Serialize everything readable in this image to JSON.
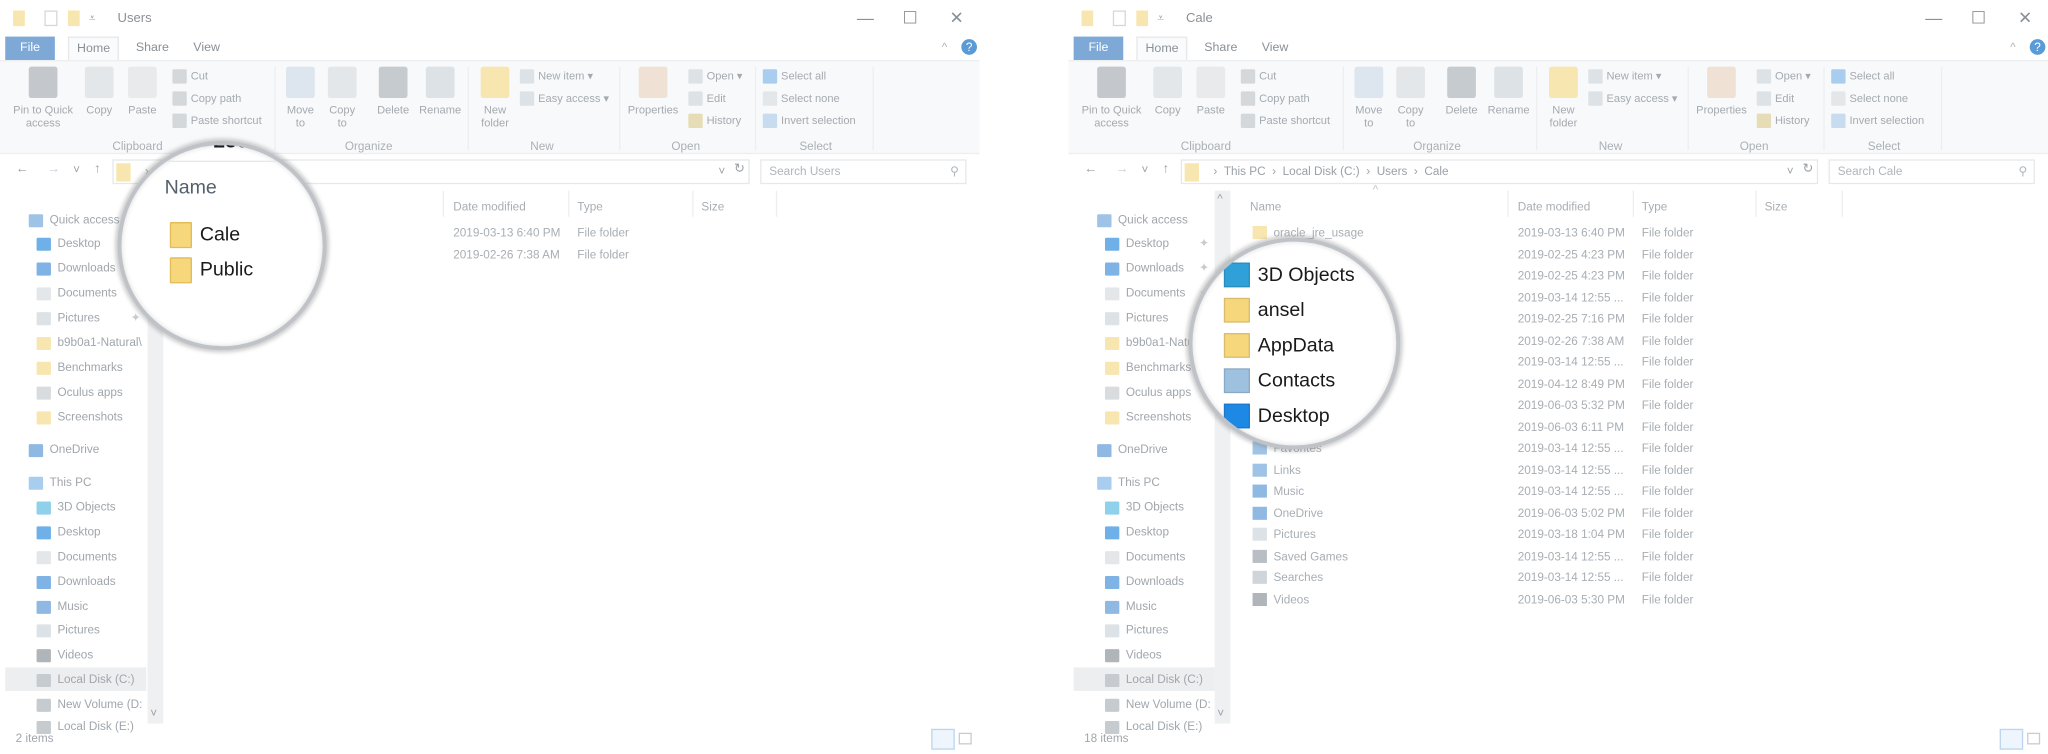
{
  "colors": {
    "file_tab": "#7ea9d6",
    "folder": "#f6d77c",
    "selection": "#eceef0"
  },
  "ribbon": {
    "tabs": [
      "File",
      "Home",
      "Share",
      "View"
    ],
    "clipboard": {
      "label": "Clipboard",
      "pin": "Pin to Quick access",
      "copy": "Copy",
      "paste": "Paste",
      "cut": "Cut",
      "copy_path": "Copy path",
      "paste_shortcut": "Paste shortcut"
    },
    "organize": {
      "label": "Organize",
      "move_to": "Move to",
      "copy_to": "Copy to",
      "delete": "Delete",
      "rename": "Rename"
    },
    "new": {
      "label": "New",
      "new_folder": "New folder",
      "new_item": "New item ▾",
      "easy_access": "Easy access ▾"
    },
    "open": {
      "label": "Open",
      "properties": "Properties",
      "open": "Open ▾",
      "edit": "Edit",
      "history": "History"
    },
    "select": {
      "label": "Select",
      "select_all": "Select all",
      "select_none": "Select none",
      "invert": "Invert selection"
    }
  },
  "columns": {
    "name": "Name",
    "date": "Date modified",
    "type": "Type",
    "size": "Size"
  },
  "nav_items": [
    {
      "label": "Quick access",
      "icon": "star-icon"
    },
    {
      "label": "Desktop",
      "icon": "desktop-icon",
      "pinned": true
    },
    {
      "label": "Downloads",
      "icon": "download-icon",
      "pinned": true
    },
    {
      "label": "Documents",
      "icon": "document-icon",
      "pinned": true
    },
    {
      "label": "Pictures",
      "icon": "pictures-icon",
      "pinned": true
    },
    {
      "label": "b9b0a1-Natural\\",
      "icon": "folder-icon"
    },
    {
      "label": "Benchmarks",
      "icon": "folder-icon"
    },
    {
      "label": "Oculus apps",
      "icon": "oculus-icon"
    },
    {
      "label": "Screenshots",
      "icon": "folder-icon"
    },
    {
      "label": "OneDrive",
      "icon": "cloud-icon"
    },
    {
      "label": "This PC",
      "icon": "computer-icon"
    },
    {
      "label": "3D Objects",
      "icon": "cube-icon"
    },
    {
      "label": "Desktop",
      "icon": "desktop-icon"
    },
    {
      "label": "Documents",
      "icon": "document-icon"
    },
    {
      "label": "Downloads",
      "icon": "download-icon"
    },
    {
      "label": "Music",
      "icon": "music-icon"
    },
    {
      "label": "Pictures",
      "icon": "pictures-icon"
    },
    {
      "label": "Videos",
      "icon": "video-icon"
    },
    {
      "label": "Local Disk (C:)",
      "icon": "drive-icon",
      "selected": true
    },
    {
      "label": "New Volume (D:",
      "icon": "drive-icon"
    },
    {
      "label": "Local Disk (E:)",
      "icon": "drive-icon"
    }
  ],
  "windows": [
    {
      "title": "Users",
      "breadcrumb": [
        "Users"
      ],
      "search_placeholder": "Search Users",
      "status": "2 items",
      "rows": [
        {
          "name": "Cale",
          "date": "2019-03-13 6:40 PM",
          "type": "File folder"
        },
        {
          "name": "Public",
          "date": "2019-02-26 7:38 AM",
          "type": "File folder"
        }
      ],
      "magnifier": {
        "header": "Name",
        "top_fragment": "Loc",
        "items": [
          {
            "name": "Cale",
            "icon": "folder-icon"
          },
          {
            "name": "Public",
            "icon": "folder-icon"
          }
        ]
      }
    },
    {
      "title": "Cale",
      "breadcrumb": [
        "This PC",
        "Local Disk (C:)",
        "Users",
        "Cale"
      ],
      "search_placeholder": "Search Cale",
      "status": "18 items",
      "rows": [
        {
          "name": "oracle_jre_usage",
          "icon": "folder-icon",
          "date": "2019-03-13 6:40 PM",
          "type": "File folder"
        },
        {
          "name": "",
          "icon": "folder-icon",
          "date": "2019-02-25 4:23 PM",
          "type": "File folder"
        },
        {
          "name": "",
          "icon": "folder-icon",
          "date": "2019-02-25 4:23 PM",
          "type": "File folder"
        },
        {
          "name": "3D Objects",
          "icon": "cube-icon",
          "date": "2019-03-14 12:55 ...",
          "type": "File folder"
        },
        {
          "name": "ansel",
          "icon": "folder-icon",
          "date": "2019-02-25 7:16 PM",
          "type": "File folder"
        },
        {
          "name": "AppData",
          "icon": "folder-icon",
          "date": "2019-02-26 7:38 AM",
          "type": "File folder"
        },
        {
          "name": "Contacts",
          "icon": "contacts-icon",
          "date": "2019-03-14 12:55 ...",
          "type": "File folder"
        },
        {
          "name": "Desktop",
          "icon": "desktop-icon",
          "date": "2019-04-12 8:49 PM",
          "type": "File folder"
        },
        {
          "name": "",
          "icon": "document-icon",
          "date": "2019-06-03 5:32 PM",
          "type": "File folder"
        },
        {
          "name": "",
          "icon": "download-icon",
          "date": "2019-06-03 6:11 PM",
          "type": "File folder"
        },
        {
          "name": "Favorites",
          "icon": "star-icon",
          "date": "2019-03-14 12:55 ...",
          "type": "File folder"
        },
        {
          "name": "Links",
          "icon": "link-icon",
          "date": "2019-03-14 12:55 ...",
          "type": "File folder"
        },
        {
          "name": "Music",
          "icon": "music-icon",
          "date": "2019-03-14 12:55 ...",
          "type": "File folder"
        },
        {
          "name": "OneDrive",
          "icon": "cloud-icon",
          "date": "2019-06-03 5:02 PM",
          "type": "File folder"
        },
        {
          "name": "Pictures",
          "icon": "pictures-icon",
          "date": "2019-03-18 1:04 PM",
          "type": "File folder"
        },
        {
          "name": "Saved Games",
          "icon": "games-icon",
          "date": "2019-03-14 12:55 ...",
          "type": "File folder"
        },
        {
          "name": "Searches",
          "icon": "search-icon",
          "date": "2019-03-14 12:55 ...",
          "type": "File folder"
        },
        {
          "name": "Videos",
          "icon": "video-icon",
          "date": "2019-06-03 5:30 PM",
          "type": "File folder"
        }
      ],
      "magnifier": {
        "items": [
          {
            "name": "3D Objects",
            "icon": "cube-icon"
          },
          {
            "name": "ansel",
            "icon": "folder-icon"
          },
          {
            "name": "AppData",
            "icon": "folder-icon"
          },
          {
            "name": "Contacts",
            "icon": "contacts-icon"
          },
          {
            "name": "Desktop",
            "icon": "desktop-icon"
          }
        ]
      }
    }
  ]
}
